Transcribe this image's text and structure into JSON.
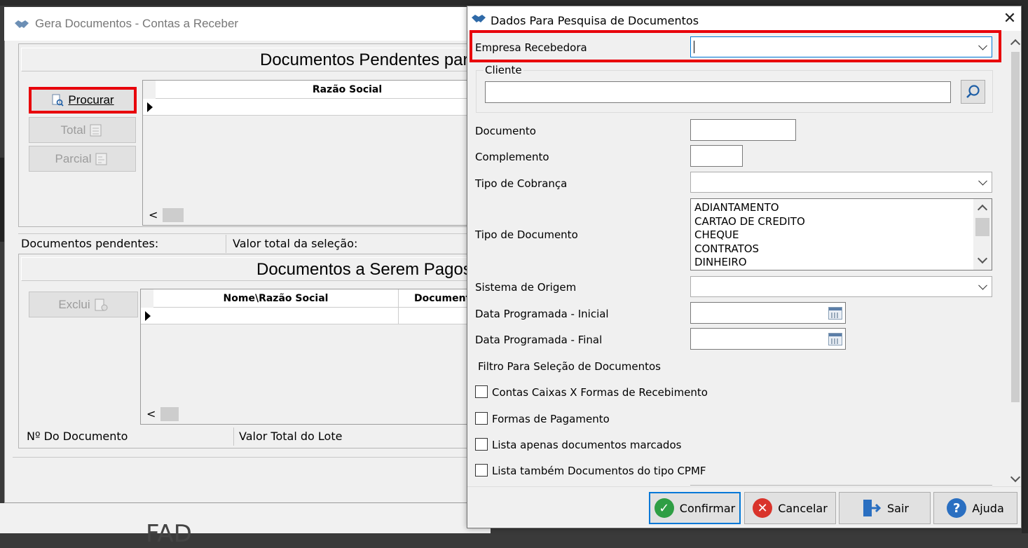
{
  "background": {
    "bottom_text": "FAD"
  },
  "back_window": {
    "title": "Gera Documentos - Contas a Receber",
    "pending_section_title": "Documentos Pendentes para",
    "buttons": {
      "procurar": "Procurar",
      "total": "Total",
      "parcial": "Parcial",
      "exclui": "Exclui"
    },
    "grid1_header": "Razão Social",
    "pending_label": "Documentos pendentes:",
    "selection_total_label": "Valor total da seleção:",
    "to_pay_section_title": "Documentos a Serem Pagos",
    "grid2_headers": [
      "Nome\\Razão Social",
      "Document"
    ],
    "doc_number_label": "Nº Do Documento",
    "lot_total_label": "Valor Total do Lote"
  },
  "dialog": {
    "title": "Dados Para Pesquisa de Documentos",
    "fields": {
      "empresa_recebedora": "Empresa Recebedora",
      "cliente": "Cliente",
      "documento": "Documento",
      "complemento": "Complemento",
      "tipo_cobranca": "Tipo de Cobrança",
      "tipo_documento": "Tipo de Documento",
      "sistema_origem": "Sistema de Origem",
      "data_inicial": "Data Programada - Inicial",
      "data_final": "Data Programada - Final"
    },
    "tipo_documento_options": [
      "ADIANTAMENTO",
      "CARTAO DE CREDITO",
      "CHEQUE",
      "CONTRATOS",
      "DINHEIRO"
    ],
    "filter_title": "Filtro Para Seleção de Documentos",
    "checkboxes": [
      "Contas Caixas X Formas de Recebimento",
      "Formas de Pagamento",
      "Lista apenas documentos marcados",
      "Lista também Documentos do tipo CPMF"
    ],
    "buttons": {
      "confirmar": "Confirmar",
      "cancelar": "Cancelar",
      "sair": "Sair",
      "ajuda": "Ajuda"
    }
  },
  "colors": {
    "highlight": "#e8000b",
    "confirm_green": "#2e9e44",
    "cancel_red": "#d9342b",
    "help_blue": "#2a6fc1",
    "search_blue": "#1f5fa6"
  },
  "icons": [
    "handshake-logo-icon",
    "document-search-icon",
    "magnifier-icon",
    "check-circle-icon",
    "x-circle-icon",
    "exit-door-icon",
    "question-circle-icon",
    "calendar-icon",
    "close-icon"
  ]
}
